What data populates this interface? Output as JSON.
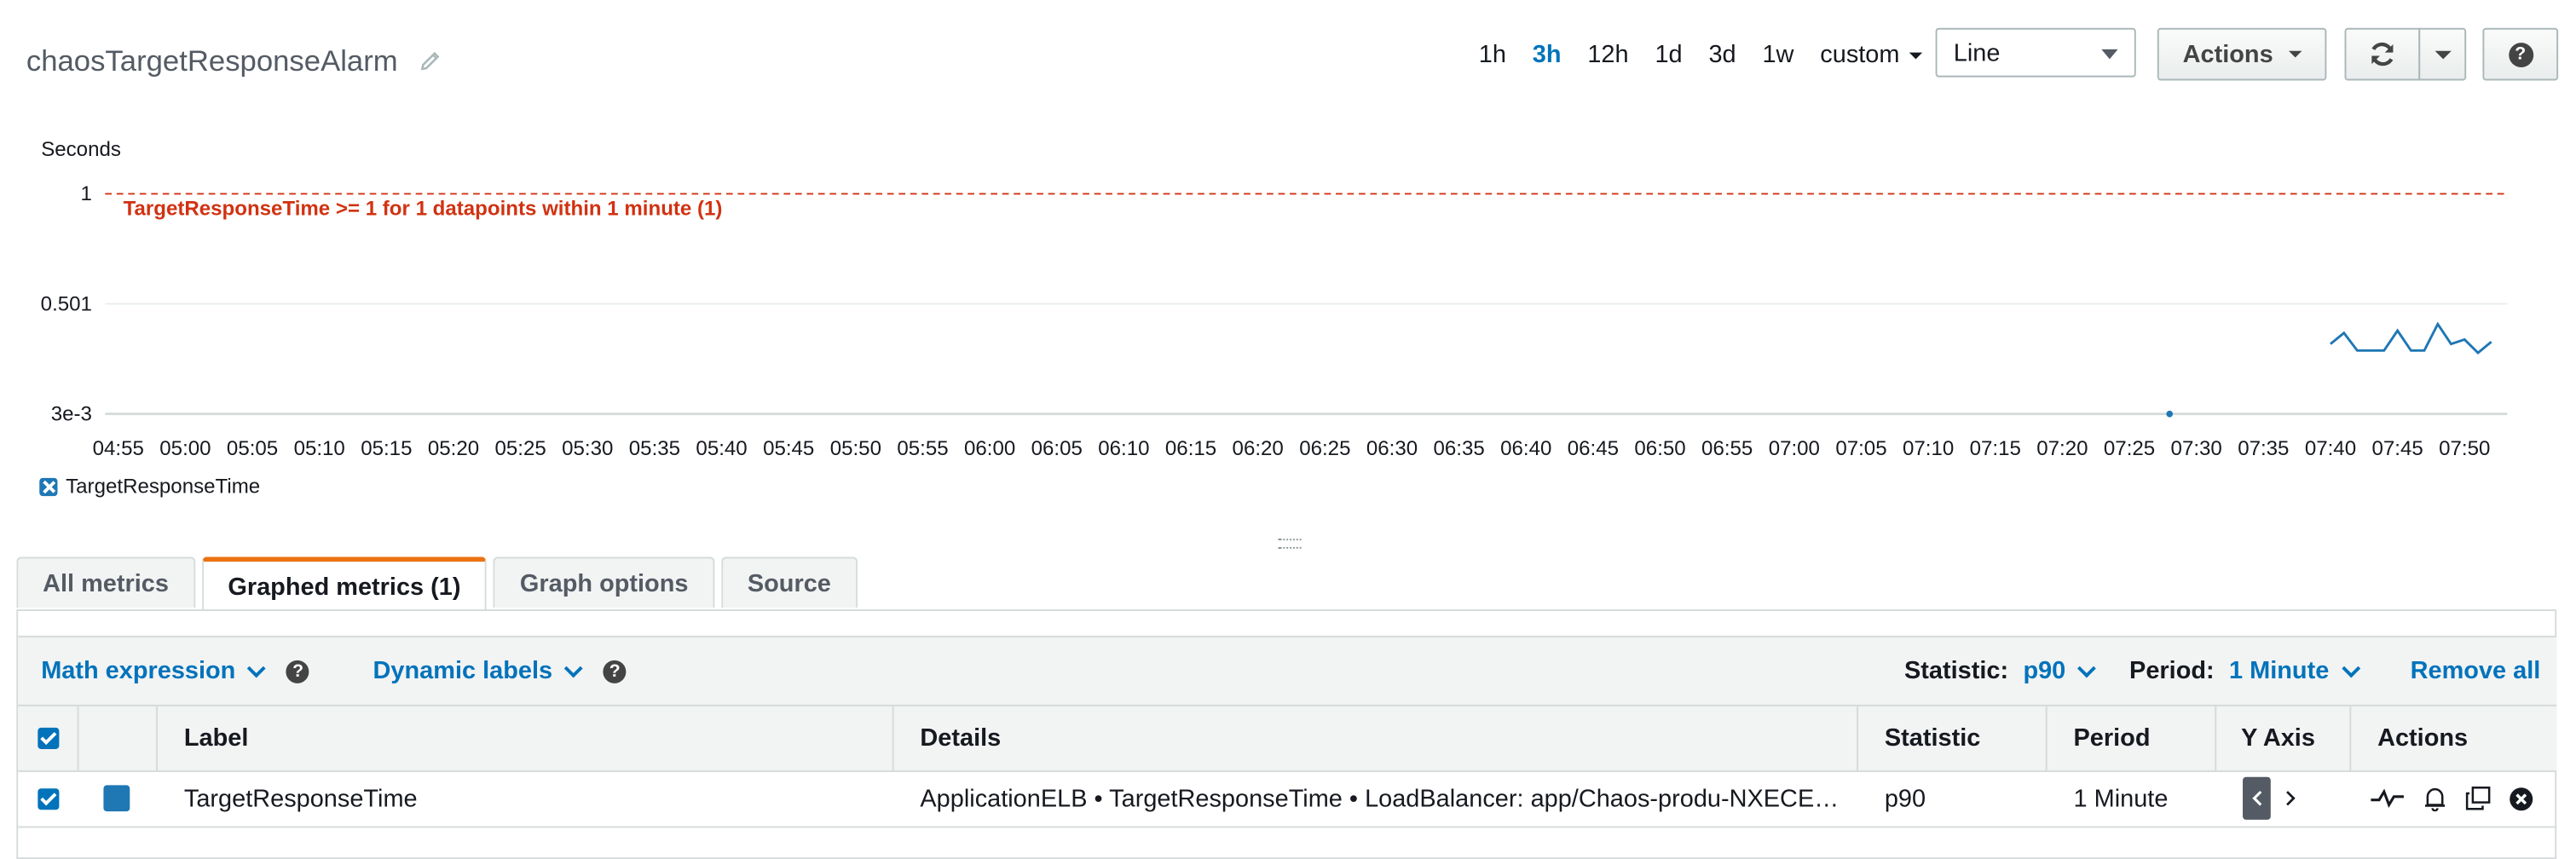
{
  "header": {
    "title": "chaosTargetResponseAlarm",
    "time_ranges": [
      "1h",
      "3h",
      "12h",
      "1d",
      "3d",
      "1w"
    ],
    "active_range": "3h",
    "custom_label": "custom",
    "graph_type": "Line",
    "actions_label": "Actions",
    "help_label": "?"
  },
  "chart_data": {
    "type": "line",
    "ylabel": "Seconds",
    "y_ticks": [
      "1",
      "0.501",
      "3e-3"
    ],
    "ylim": [
      0.003,
      1
    ],
    "x_ticks": [
      "04:55",
      "05:00",
      "05:05",
      "05:10",
      "05:15",
      "05:20",
      "05:25",
      "05:30",
      "05:35",
      "05:40",
      "05:45",
      "05:50",
      "05:55",
      "06:00",
      "06:05",
      "06:10",
      "06:15",
      "06:20",
      "06:25",
      "06:30",
      "06:35",
      "06:40",
      "06:45",
      "06:50",
      "06:55",
      "07:00",
      "07:05",
      "07:10",
      "07:15",
      "07:20",
      "07:25",
      "07:30",
      "07:35",
      "07:40",
      "07:45",
      "07:50"
    ],
    "threshold": {
      "value": 1,
      "label": "TargetResponseTime >= 1 for 1 datapoints within 1 minute (1)",
      "color": "#d13212"
    },
    "series": [
      {
        "name": "TargetResponseTime",
        "color": "#1f77b4",
        "points": [
          {
            "t": "07:28",
            "v": 0.003
          },
          {
            "t": "07:40",
            "v": 0.32
          },
          {
            "t": "07:41",
            "v": 0.37
          },
          {
            "t": "07:42",
            "v": 0.29
          },
          {
            "t": "07:43",
            "v": 0.29
          },
          {
            "t": "07:44",
            "v": 0.29
          },
          {
            "t": "07:45",
            "v": 0.38
          },
          {
            "t": "07:46",
            "v": 0.29
          },
          {
            "t": "07:47",
            "v": 0.29
          },
          {
            "t": "07:48",
            "v": 0.41
          },
          {
            "t": "07:49",
            "v": 0.32
          },
          {
            "t": "07:50",
            "v": 0.34
          },
          {
            "t": "07:51",
            "v": 0.28
          },
          {
            "t": "07:52",
            "v": 0.33
          }
        ]
      }
    ],
    "legend": [
      "TargetResponseTime"
    ],
    "grid": true
  },
  "tabs": [
    "All metrics",
    "Graphed metrics (1)",
    "Graph options",
    "Source"
  ],
  "active_tab": "Graphed metrics (1)",
  "metrics_toolbar": {
    "math_expression": "Math expression",
    "dynamic_labels": "Dynamic labels",
    "statistic_label": "Statistic:",
    "statistic_value": "p90",
    "period_label": "Period:",
    "period_value": "1 Minute",
    "remove_all": "Remove all"
  },
  "table": {
    "columns": [
      "Label",
      "Details",
      "Statistic",
      "Period",
      "Y Axis",
      "Actions"
    ],
    "rows": [
      {
        "label": "TargetResponseTime",
        "details": "ApplicationELB • TargetResponseTime • LoadBalancer: app/Chaos-produ-NXECE…",
        "statistic": "p90",
        "period": "1 Minute"
      }
    ]
  }
}
